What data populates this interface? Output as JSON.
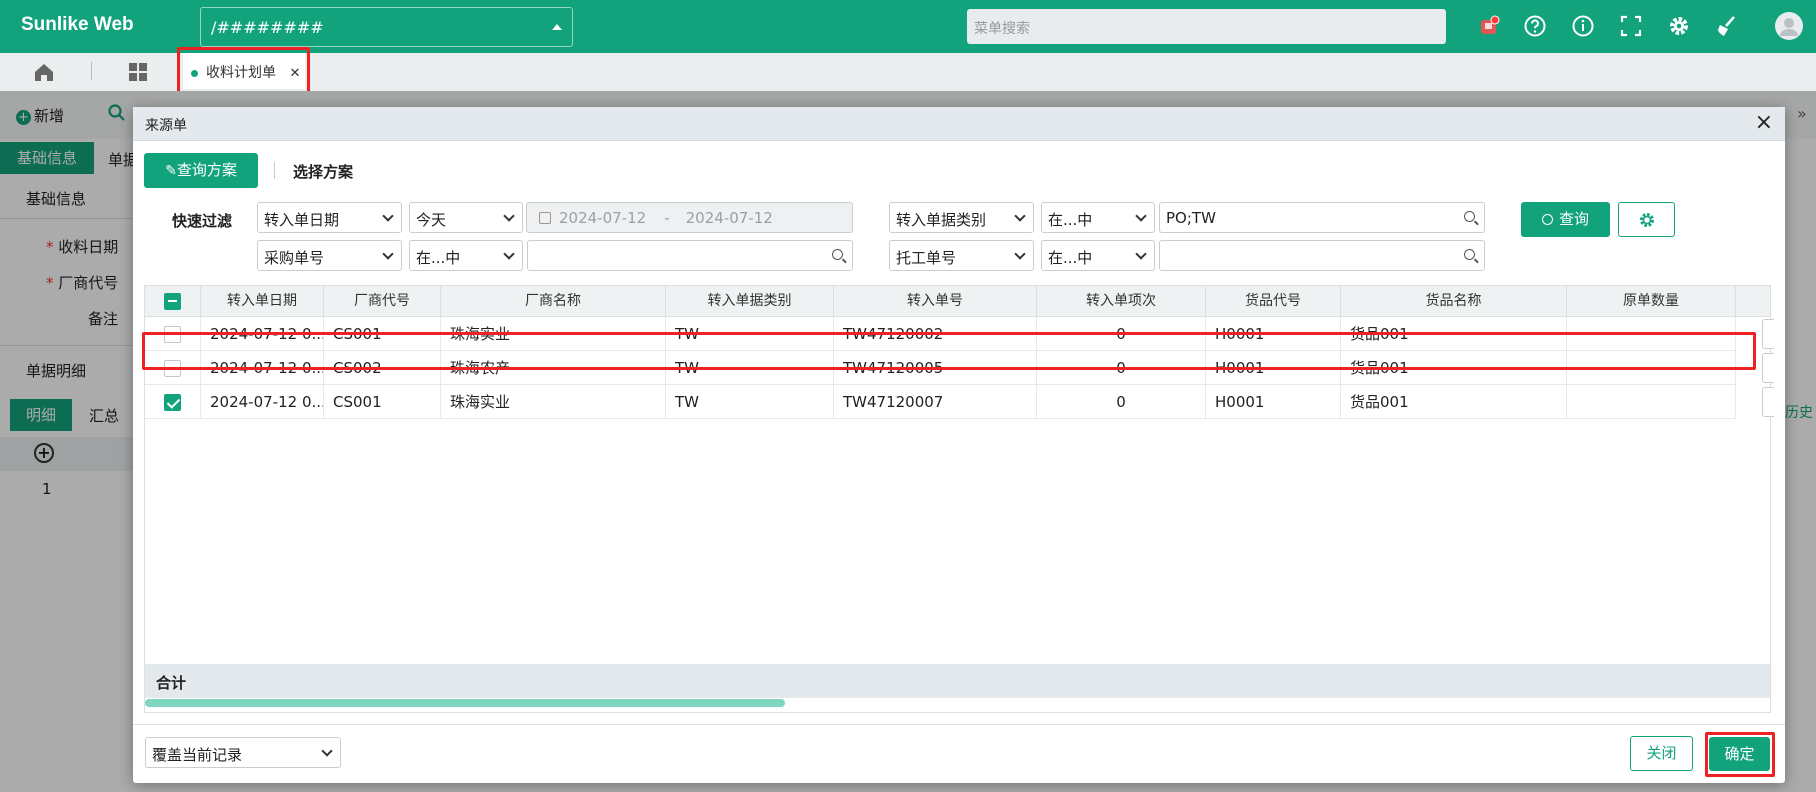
{
  "app": {
    "logo": "Sunlike Web",
    "path_value": "/########",
    "menu_search_placeholder": "菜单搜索"
  },
  "header_icons": [
    "notification-icon",
    "help-icon",
    "info-icon",
    "fullscreen-icon",
    "gear-icon",
    "clear-icon",
    "avatar-icon"
  ],
  "tabs": {
    "active_label": "收料计划单"
  },
  "background": {
    "toolbar_new": "新增",
    "tab_basic": "基础信息",
    "tab_bill_short": "单据",
    "section_basic": "基础信息",
    "field_date": "收料日期",
    "field_vendor": "厂商代号",
    "field_remark": "备注",
    "section_detail": "单据明细",
    "subtab_detail": "明细",
    "subtab_summary": "汇总",
    "row_no": "1",
    "history_short": "历史"
  },
  "dialog": {
    "title": "来源单",
    "scheme_query": "查询方案",
    "scheme_select": "选择方案",
    "quick_filter_label": "快速过滤",
    "filters": {
      "row1": {
        "field1": "转入单日期",
        "op1": "今天",
        "date_from": "2024-07-12",
        "date_sep": "-",
        "date_to": "2024-07-12",
        "field2": "转入单据类别",
        "op2": "在...中",
        "value2": "PO;TW"
      },
      "row2": {
        "field1": "采购单号",
        "op1": "在...中",
        "value1": "",
        "field2": "托工单号",
        "op2": "在...中",
        "value2": ""
      }
    },
    "query_button": "查询",
    "table": {
      "columns": [
        "转入单日期",
        "厂商代号",
        "厂商名称",
        "转入单据类别",
        "转入单号",
        "转入单项次",
        "货品代号",
        "货品名称",
        "原单数量"
      ],
      "rows": [
        {
          "checked": false,
          "date": "2024-07-12 0...",
          "vendor_code": "CS001",
          "vendor_name": "珠海实业",
          "type": "TW",
          "bill_no": "TW47120002",
          "item_no": "0",
          "goods_code": "H0001",
          "goods_name": "货品001",
          "qty": ""
        },
        {
          "checked": false,
          "date": "2024-07-12 0...",
          "vendor_code": "CS002",
          "vendor_name": "珠海农产",
          "type": "TW",
          "bill_no": "TW47120005",
          "item_no": "0",
          "goods_code": "H0001",
          "goods_name": "货品001",
          "qty": ""
        },
        {
          "checked": true,
          "date": "2024-07-12 0...",
          "vendor_code": "CS001",
          "vendor_name": "珠海实业",
          "type": "TW",
          "bill_no": "TW47120007",
          "item_no": "0",
          "goods_code": "H0001",
          "goods_name": "货品001",
          "qty": ""
        }
      ],
      "total_label": "合计"
    },
    "mode_select": "覆盖当前记录",
    "close_button": "关闭",
    "confirm_button": "确定"
  },
  "colors": {
    "brand": "#12a37d",
    "highlight": "#ee2222",
    "header_bg": "#e3e9ec"
  }
}
